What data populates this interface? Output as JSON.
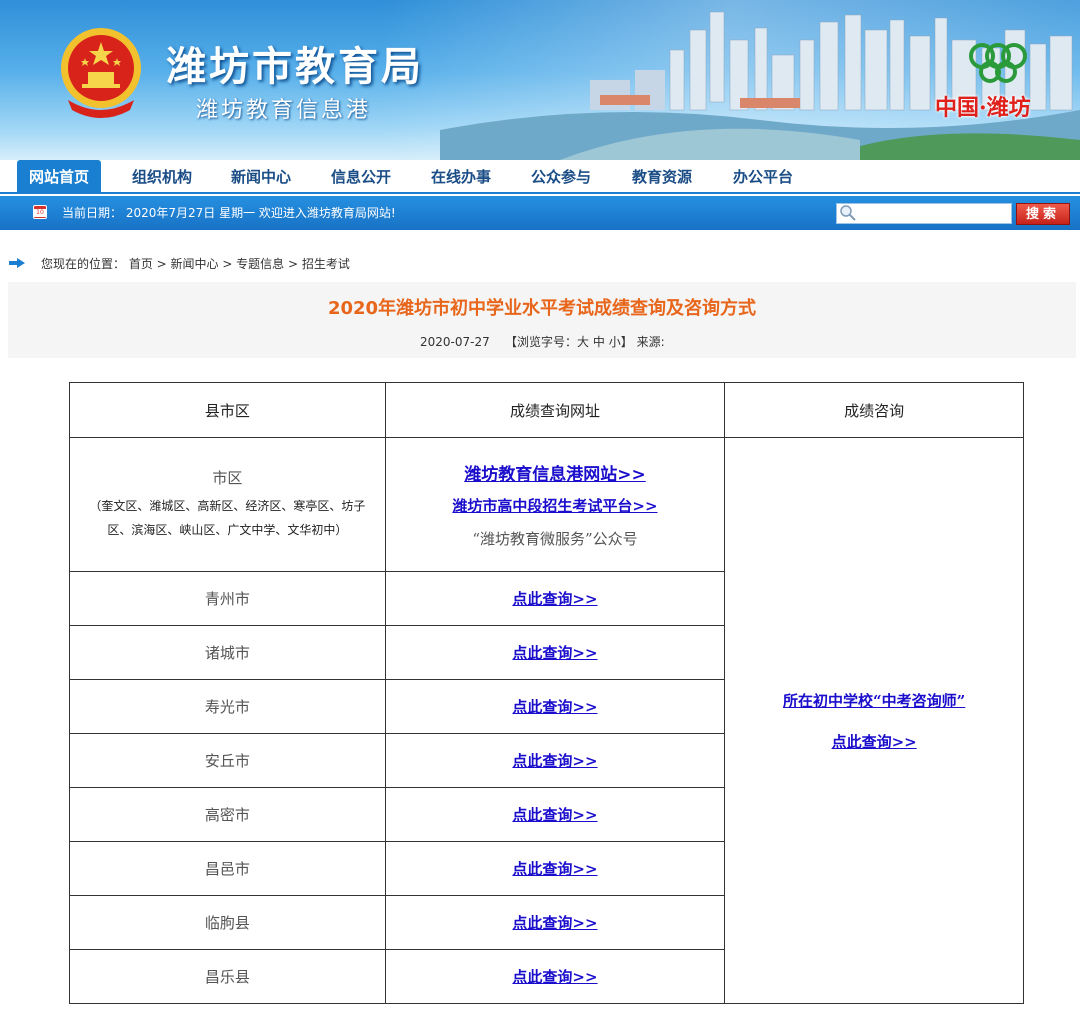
{
  "header": {
    "site_title": "潍坊市教育局",
    "site_subtitle": "潍坊教育信息港",
    "city_tag": "中国·潍坊"
  },
  "nav": {
    "items": [
      {
        "label": "网站首页",
        "active": true
      },
      {
        "label": "组织机构"
      },
      {
        "label": "新闻中心"
      },
      {
        "label": "信息公开"
      },
      {
        "label": "在线办事"
      },
      {
        "label": "公众参与"
      },
      {
        "label": "教育资源"
      },
      {
        "label": "办公平台"
      }
    ]
  },
  "datebar": {
    "text": "当前日期：  2020年7月27日 星期一 欢迎进入潍坊教育局网站!",
    "search_button": "搜索"
  },
  "breadcrumb": {
    "text": "您现在的位置：  首页 > 新闻中心 > 专题信息 > 招生考试"
  },
  "article": {
    "title": "2020年潍坊市初中学业水平考试成绩查询及咨询方式",
    "date": "2020-07-27",
    "font_label_open": "【浏览字号：",
    "font_large": "大",
    "font_medium": "中",
    "font_small": "小",
    "font_label_close": "】",
    "source_label": "来源:"
  },
  "table": {
    "headers": [
      "县市区",
      "成绩查询网址",
      "成绩咨询"
    ],
    "first_row": {
      "district": "市区",
      "district_note": "（奎文区、潍城区、高新区、经济区、寒亭区、坊子区、滨海区、峡山区、广文中学、文华初中）",
      "link1": "潍坊教育信息港网站>>",
      "link2": "潍坊市高中段招生考试平台>>",
      "plain": "“潍坊教育微服务”公众号"
    },
    "rows": [
      {
        "district": "青州市",
        "link": "点此查询>>"
      },
      {
        "district": "诸城市",
        "link": "点此查询>>"
      },
      {
        "district": "寿光市",
        "link": "点此查询>>"
      },
      {
        "district": "安丘市",
        "link": "点此查询>>"
      },
      {
        "district": "高密市",
        "link": "点此查询>>"
      },
      {
        "district": "昌邑市",
        "link": "点此查询>>"
      },
      {
        "district": "临朐县",
        "link": "点此查询>>"
      },
      {
        "district": "昌乐县",
        "link": "点此查询>>"
      }
    ],
    "consult": {
      "line1": "所在初中学校“中考咨询师”",
      "line2": "点此查询>>"
    }
  },
  "colors": {
    "nav_blue": "#1a7fd0",
    "title_orange": "#e8661b",
    "link_blue": "#1a0dcc",
    "search_red": "#c6231a"
  }
}
